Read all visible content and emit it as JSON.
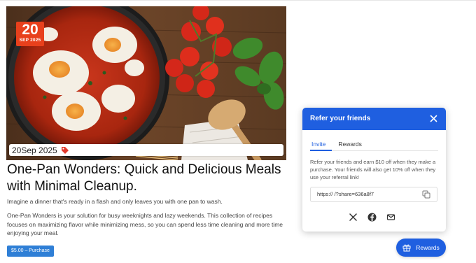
{
  "post": {
    "date_day": "20",
    "date_month": "SEP 2025",
    "date_text": "20Sep 2025",
    "title": "One-Pan Wonders: Quick and Delicious Meals with Minimal Cleanup.",
    "excerpt": "Imagine a dinner that's ready in a flash and only leaves you with one pan to wash.",
    "body": "One-Pan Wonders is your solution for busy weeknights and lazy weekends. This collection of recipes focuses on maximizing flavor while minimizing mess, so you can spend less time cleaning and more time enjoying your meal.",
    "purchase_label": "$5.00 – Purchase",
    "image_icon": "shakshuka-pan-photo",
    "tag_icon": "tag-icon"
  },
  "referral": {
    "title": "Refer your friends",
    "close_icon": "close-icon",
    "tabs": [
      {
        "label": "Invite",
        "active": true
      },
      {
        "label": "Rewards",
        "active": false
      }
    ],
    "description": "Refer your friends and earn $10 off when they make a purchase. Your friends will also get 10% off when they use your referral link!",
    "link_text": "https:// /?share=636a8f7",
    "copy_icon": "copy-icon",
    "share_icons": [
      "x-icon",
      "facebook-icon",
      "mail-icon"
    ]
  },
  "rewards_button": {
    "label": "Rewards",
    "icon": "gift-icon"
  },
  "colors": {
    "brand_blue": "#1f5fe0",
    "date_badge": "#e8401c",
    "purchase_button": "#2f7fd6"
  }
}
